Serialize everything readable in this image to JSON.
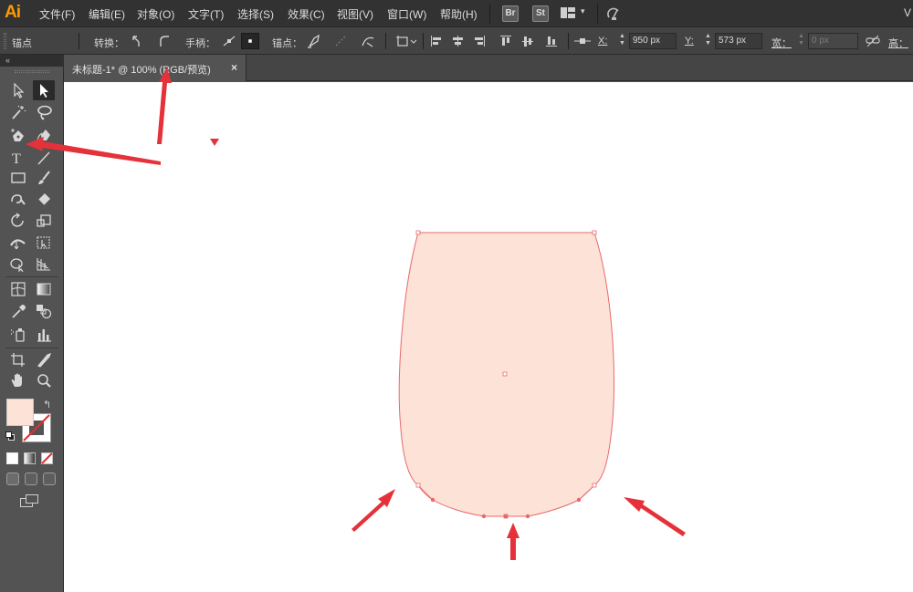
{
  "app": {
    "logo": "Ai",
    "menu": [
      "文件(F)",
      "编辑(E)",
      "对象(O)",
      "文字(T)",
      "选择(S)",
      "效果(C)",
      "视图(V)",
      "窗口(W)",
      "帮助(H)"
    ],
    "bridge_icons": [
      "Br",
      "St"
    ],
    "right_cut_text": "V"
  },
  "control_bar": {
    "context_label": "锚点",
    "convert_label": "转换：",
    "handles_label": "手柄：",
    "anchors_label": "锚点：",
    "x_label": "X:",
    "x_value": "950 px",
    "y_label": "Y:",
    "y_value": "573 px",
    "width_label": "宽：",
    "width_value": "0 px",
    "height_label": "高："
  },
  "document_tab": {
    "title": "未标题-1* @ 100% (RGB/预览)",
    "close": "×"
  },
  "tools": {
    "collapse_glyph": "«",
    "type_tool_glyph": "T",
    "swap_glyph": "↰"
  },
  "colors": {
    "menubar": "#323232",
    "controlbar": "#434343",
    "panel": "#535353",
    "fill_color": "#fde2d8",
    "path_stroke": "#e8686b",
    "annotation_red": "#e5313a",
    "logo_orange": "#ff9a00"
  }
}
